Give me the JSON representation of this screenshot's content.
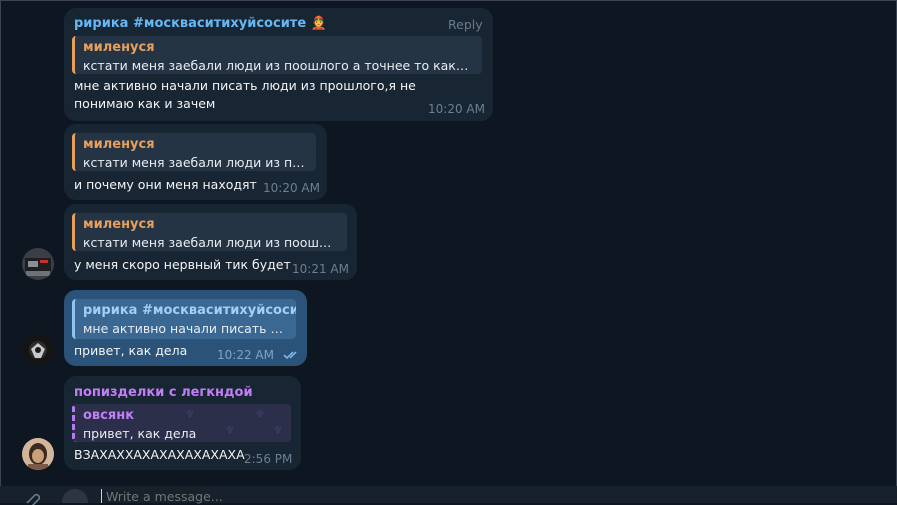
{
  "messages": [
    {
      "sender": "ририка #москваситихуйсосите 👲",
      "reply_label": "Reply",
      "quote_author": "миленуся",
      "quote_text": "кстати меня заебали люди из поошлого а точнее то какими...",
      "text": "мне активно начали писать люди из прошлого,я не понимаю как и зачем",
      "time": "10:20 AM"
    },
    {
      "quote_author": "миленуся",
      "quote_text": "кстати меня заебали люди из поо...",
      "text": "и почему они меня находят",
      "time": "10:20 AM"
    },
    {
      "quote_author": "миленуся",
      "quote_text": "кстати меня заебали люди из поошло...",
      "text": "у меня скоро нервный тик будет",
      "time": "10:21 AM"
    },
    {
      "quote_author": "ририка #москваситихуйсосите",
      "quote_text": "мне активно начали писать л...",
      "text": "привет, как дела",
      "time": "10:22 AM",
      "status": "double-check-icon"
    },
    {
      "sender": "попизделки с легкндой",
      "quote_author": "овсянк",
      "quote_text": "привет, как дела",
      "text": "ВЗАХАХХАХАХАХАХАХАХА",
      "time": "2:56 PM"
    }
  ],
  "composer": {
    "placeholder": "Write a message..."
  },
  "colors": {
    "background": "#0e1621",
    "incoming_bubble": "#182533",
    "outgoing_bubble": "#2b5278",
    "sender_blue": "#66b8f5",
    "quote_orange": "#e79f5c",
    "sender_purple": "#c17ff5"
  }
}
